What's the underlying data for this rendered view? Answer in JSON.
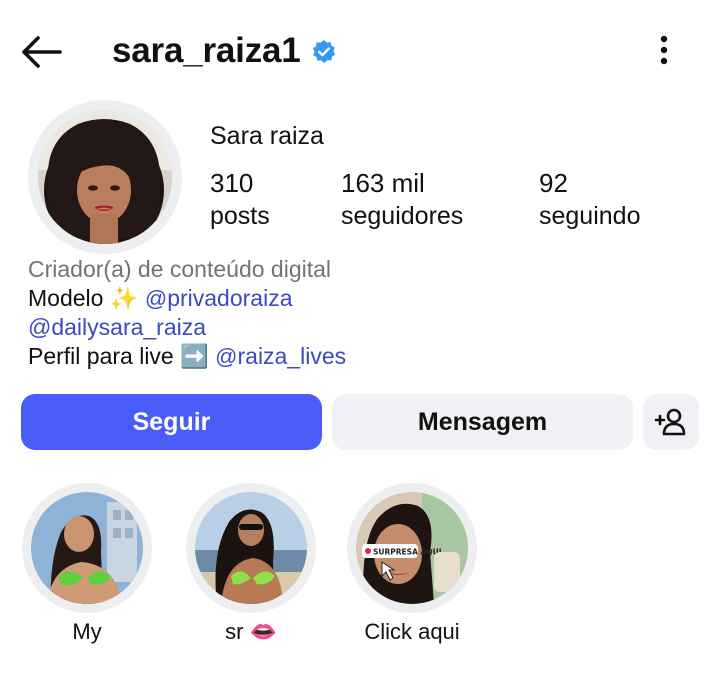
{
  "header": {
    "username": "sara_raiza1",
    "verified": true,
    "back_icon": "arrow-left-icon",
    "more_icon": "more-vertical-icon"
  },
  "profile": {
    "display_name": "Sara raiza",
    "stats": [
      {
        "value": "310",
        "label": "posts"
      },
      {
        "value": "163 mil",
        "label": "seguidores"
      },
      {
        "value": "92",
        "label": "seguindo"
      }
    ]
  },
  "bio": {
    "category": "Criador(a) de conteúdo digital",
    "line1_text": "Modelo ✨ ",
    "line1_mention": "privadoraiza",
    "line2_mention": "@dailysara_raiza",
    "line3_text": "Perfil para live ➡️ ",
    "line3_mention": "raiza_lives",
    "threads_glyph": "@"
  },
  "actions": {
    "follow_label": "Seguir",
    "message_label": "Mensagem",
    "add_icon": "add-person-icon"
  },
  "highlights": [
    {
      "label": "My"
    },
    {
      "label": "sr 👄"
    },
    {
      "label": "Click aqui",
      "overlay_text": "SURPRESA AQUI"
    }
  ],
  "colors": {
    "accent": "#4a5df9",
    "mention": "#3d49c4",
    "verified": "#3897f0",
    "secondary_button": "#eff1f4",
    "muted_text": "#737373"
  }
}
